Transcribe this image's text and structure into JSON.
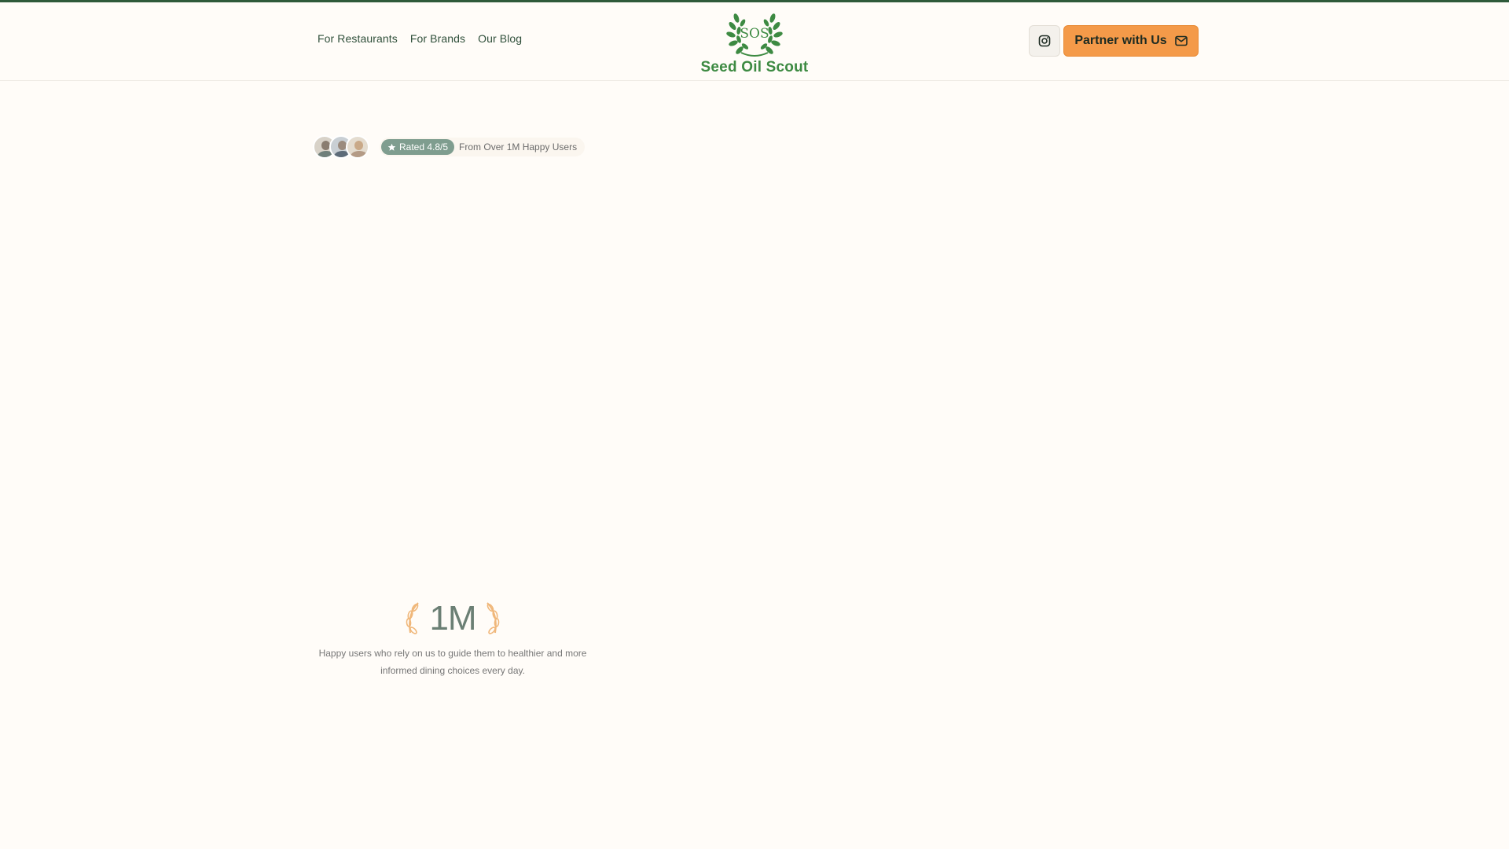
{
  "nav": {
    "items": [
      {
        "label": "For Restaurants"
      },
      {
        "label": "For Brands"
      },
      {
        "label": "Our Blog"
      }
    ]
  },
  "logo": {
    "monogram": "SOS",
    "name": "Seed Oil Scout",
    "color": "#3d8a42"
  },
  "header_actions": {
    "instagram_icon": "instagram-icon",
    "partner_label": "Partner with Us",
    "partner_icon": "mail-icon",
    "accent": "#f49a49"
  },
  "rating": {
    "badge": "Rated 4.8/5",
    "text": "From Over 1M Happy Users",
    "avatar_count": 3
  },
  "stat": {
    "value": "1M",
    "description": "Happy users who rely on us to guide them to healthier and more informed dining choices every day."
  }
}
